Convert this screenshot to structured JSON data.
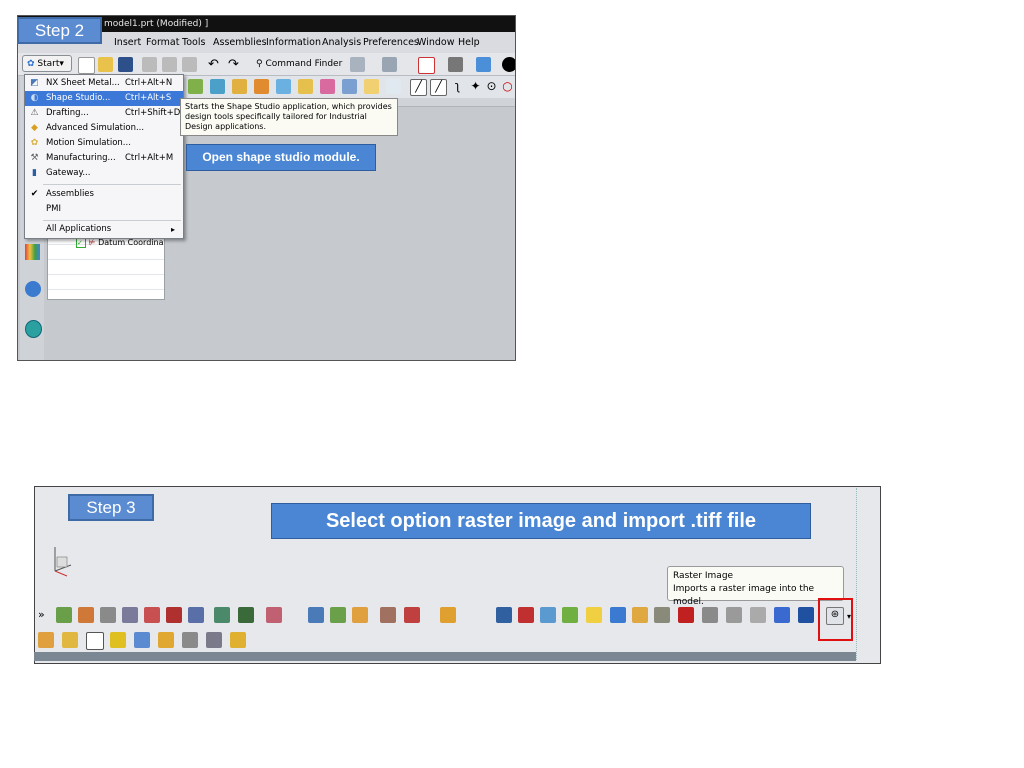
{
  "slide": {
    "step2_label": "Step 2",
    "step3_label": "Step 3",
    "callout1": "Open shape studio module.",
    "callout2": "Select option raster image and import .tiff file"
  },
  "shot1": {
    "title": "model1.prt (Modified) ]",
    "menu": [
      "Insert",
      "Format",
      "Tools",
      "Assemblies",
      "Information",
      "Analysis",
      "Preferences",
      "Window",
      "Help"
    ],
    "start_label": "Start",
    "command_finder": "Command Finder",
    "start_menu": [
      {
        "icon": "sheet-metal-icon",
        "label": "NX Sheet Metal...",
        "shortcut": "Ctrl+Alt+N"
      },
      {
        "icon": "shape-studio-icon",
        "label": "Shape Studio...",
        "shortcut": "Ctrl+Alt+S",
        "selected": true
      },
      {
        "icon": "drafting-icon",
        "label": "Drafting...",
        "shortcut": "Ctrl+Shift+D"
      },
      {
        "icon": "advanced-simulation-icon",
        "label": "Advanced Simulation...",
        "shortcut": ""
      },
      {
        "icon": "motion-simulation-icon",
        "label": "Motion Simulation...",
        "shortcut": ""
      },
      {
        "icon": "manufacturing-icon",
        "label": "Manufacturing...",
        "shortcut": "Ctrl+Alt+M"
      },
      {
        "icon": "gateway-icon",
        "label": "Gateway...",
        "shortcut": ""
      },
      {
        "icon": "check-icon",
        "label": "Assemblies",
        "shortcut": ""
      },
      {
        "icon": "",
        "label": "PMI",
        "shortcut": ""
      },
      {
        "icon": "chevron-right-icon",
        "label": "All Applications",
        "shortcut": ""
      }
    ],
    "tooltip": "Starts the Shape Studio application, which provides design tools specifically tailored for Industrial Design applications.",
    "tree_item": "Datum Coordina"
  },
  "shot2": {
    "tooltip_title": "Raster Image",
    "tooltip_text": "Imports a raster image into the model."
  },
  "colors": {
    "callout": "#4a86d4",
    "step_label": "#5b8bd0",
    "highlight": "#e01010",
    "selection": "#3c78d8"
  }
}
